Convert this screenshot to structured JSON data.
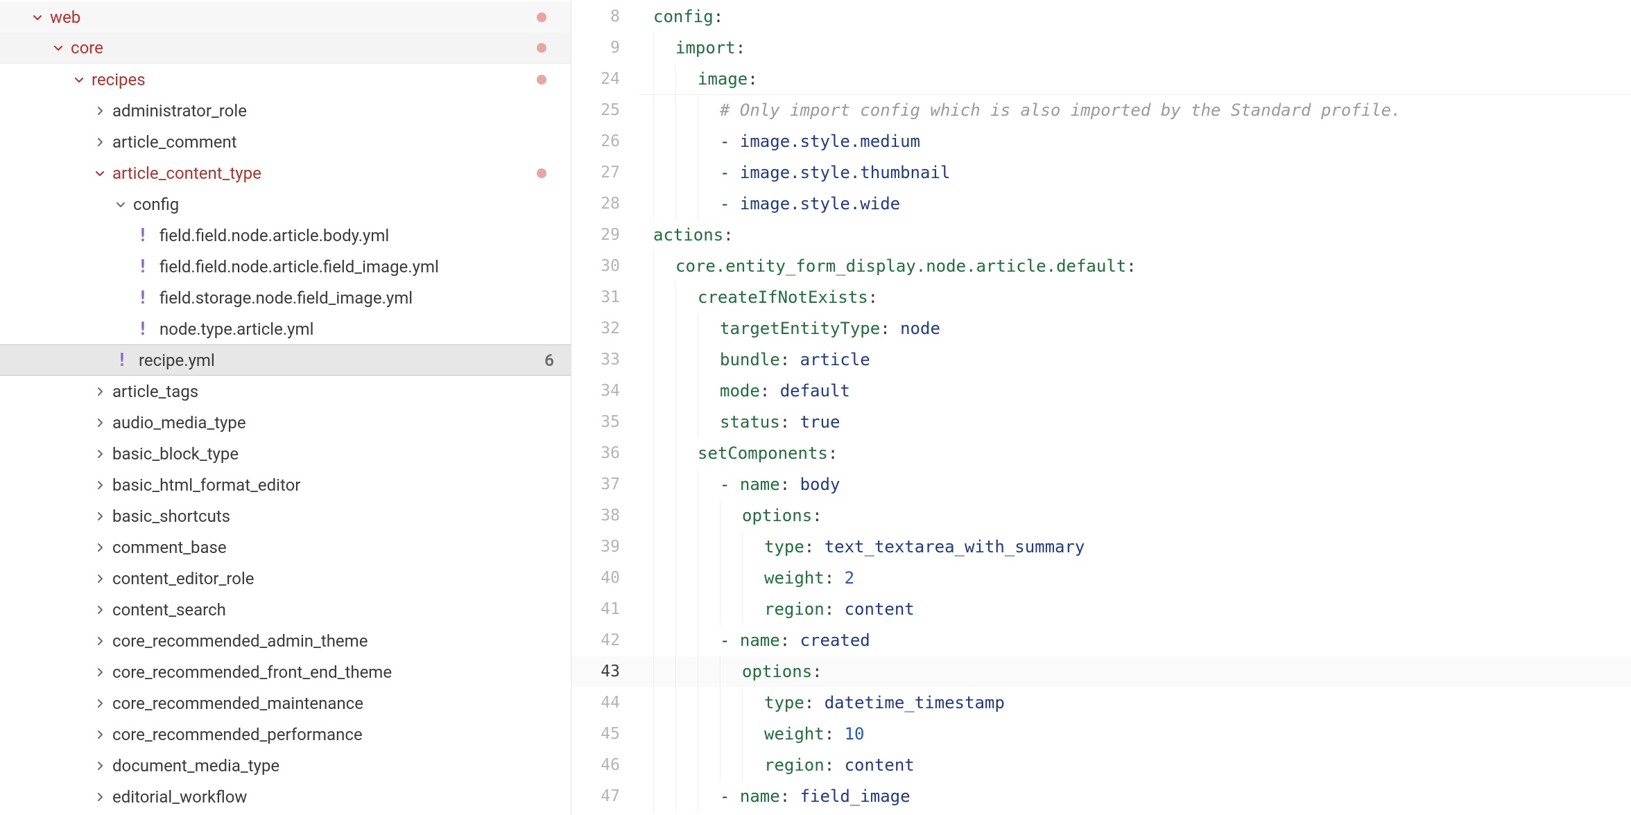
{
  "tree": {
    "items": [
      {
        "label": "web",
        "depth": 0,
        "kind": "dir",
        "expanded": true,
        "modified": true,
        "dot": true,
        "bg": "bg0"
      },
      {
        "label": "core",
        "depth": 1,
        "kind": "dir",
        "expanded": true,
        "modified": true,
        "dot": true,
        "bg": "bg1",
        "separator": true
      },
      {
        "label": "recipes",
        "depth": 2,
        "kind": "dir",
        "expanded": true,
        "modified": true,
        "dot": true
      },
      {
        "label": "administrator_role",
        "depth": 3,
        "kind": "dir",
        "expanded": false
      },
      {
        "label": "article_comment",
        "depth": 3,
        "kind": "dir",
        "expanded": false
      },
      {
        "label": "article_content_type",
        "depth": 3,
        "kind": "dir",
        "expanded": true,
        "modified": true,
        "dot": true
      },
      {
        "label": "config",
        "depth": 4,
        "kind": "dir",
        "expanded": true
      },
      {
        "label": "field.field.node.article.body.yml",
        "depth": 5,
        "kind": "file"
      },
      {
        "label": "field.field.node.article.field_image.yml",
        "depth": 5,
        "kind": "file"
      },
      {
        "label": "field.storage.node.field_image.yml",
        "depth": 5,
        "kind": "file"
      },
      {
        "label": "node.type.article.yml",
        "depth": 5,
        "kind": "file"
      },
      {
        "label": "recipe.yml",
        "depth": 4,
        "kind": "file",
        "selected": true,
        "badge": "6"
      },
      {
        "label": "article_tags",
        "depth": 3,
        "kind": "dir",
        "expanded": false
      },
      {
        "label": "audio_media_type",
        "depth": 3,
        "kind": "dir",
        "expanded": false
      },
      {
        "label": "basic_block_type",
        "depth": 3,
        "kind": "dir",
        "expanded": false
      },
      {
        "label": "basic_html_format_editor",
        "depth": 3,
        "kind": "dir",
        "expanded": false
      },
      {
        "label": "basic_shortcuts",
        "depth": 3,
        "kind": "dir",
        "expanded": false
      },
      {
        "label": "comment_base",
        "depth": 3,
        "kind": "dir",
        "expanded": false
      },
      {
        "label": "content_editor_role",
        "depth": 3,
        "kind": "dir",
        "expanded": false
      },
      {
        "label": "content_search",
        "depth": 3,
        "kind": "dir",
        "expanded": false
      },
      {
        "label": "core_recommended_admin_theme",
        "depth": 3,
        "kind": "dir",
        "expanded": false
      },
      {
        "label": "core_recommended_front_end_theme",
        "depth": 3,
        "kind": "dir",
        "expanded": false
      },
      {
        "label": "core_recommended_maintenance",
        "depth": 3,
        "kind": "dir",
        "expanded": false
      },
      {
        "label": "core_recommended_performance",
        "depth": 3,
        "kind": "dir",
        "expanded": false
      },
      {
        "label": "document_media_type",
        "depth": 3,
        "kind": "dir",
        "expanded": false
      },
      {
        "label": "editorial_workflow",
        "depth": 3,
        "kind": "dir",
        "expanded": false
      }
    ]
  },
  "editor": {
    "current_line": "43",
    "lines": [
      {
        "num": "8",
        "guides": 0,
        "border": false,
        "tokens": [
          {
            "t": "config",
            "c": "key"
          },
          {
            "t": ":",
            "c": "colon"
          }
        ]
      },
      {
        "num": "9",
        "guides": 1,
        "border": false,
        "tokens": [
          {
            "t": "import",
            "c": "key"
          },
          {
            "t": ":",
            "c": "colon"
          }
        ]
      },
      {
        "num": "24",
        "guides": 2,
        "border": true,
        "tokens": [
          {
            "t": "image",
            "c": "key"
          },
          {
            "t": ":",
            "c": "colon"
          }
        ]
      },
      {
        "num": "25",
        "guides": 3,
        "border": false,
        "tokens": [
          {
            "t": "# Only import config which is also imported by the Standard profile.",
            "c": "comment"
          }
        ]
      },
      {
        "num": "26",
        "guides": 3,
        "border": false,
        "tokens": [
          {
            "t": "- ",
            "c": "dash"
          },
          {
            "t": "image.style.medium",
            "c": "plain"
          }
        ]
      },
      {
        "num": "27",
        "guides": 3,
        "border": false,
        "tokens": [
          {
            "t": "- ",
            "c": "dash"
          },
          {
            "t": "image.style.thumbnail",
            "c": "plain"
          }
        ]
      },
      {
        "num": "28",
        "guides": 3,
        "border": false,
        "tokens": [
          {
            "t": "- ",
            "c": "dash"
          },
          {
            "t": "image.style.wide",
            "c": "plain"
          }
        ]
      },
      {
        "num": "29",
        "guides": 0,
        "border": false,
        "tokens": [
          {
            "t": "actions",
            "c": "key"
          },
          {
            "t": ":",
            "c": "colon"
          }
        ]
      },
      {
        "num": "30",
        "guides": 1,
        "border": false,
        "tokens": [
          {
            "t": "core.entity_form_display.node.article.default",
            "c": "key"
          },
          {
            "t": ":",
            "c": "colon"
          }
        ]
      },
      {
        "num": "31",
        "guides": 2,
        "border": false,
        "tokens": [
          {
            "t": "createIfNotExists",
            "c": "key"
          },
          {
            "t": ":",
            "c": "colon"
          }
        ]
      },
      {
        "num": "32",
        "guides": 3,
        "border": false,
        "tokens": [
          {
            "t": "targetEntityType",
            "c": "key"
          },
          {
            "t": ": ",
            "c": "colon"
          },
          {
            "t": "node",
            "c": "str"
          }
        ]
      },
      {
        "num": "33",
        "guides": 3,
        "border": false,
        "tokens": [
          {
            "t": "bundle",
            "c": "key"
          },
          {
            "t": ": ",
            "c": "colon"
          },
          {
            "t": "article",
            "c": "str"
          }
        ]
      },
      {
        "num": "34",
        "guides": 3,
        "border": false,
        "tokens": [
          {
            "t": "mode",
            "c": "key"
          },
          {
            "t": ": ",
            "c": "colon"
          },
          {
            "t": "default",
            "c": "str"
          }
        ]
      },
      {
        "num": "35",
        "guides": 3,
        "border": false,
        "tokens": [
          {
            "t": "status",
            "c": "key"
          },
          {
            "t": ": ",
            "c": "colon"
          },
          {
            "t": "true",
            "c": "bool"
          }
        ]
      },
      {
        "num": "36",
        "guides": 2,
        "border": false,
        "tokens": [
          {
            "t": "setComponents",
            "c": "key"
          },
          {
            "t": ":",
            "c": "colon"
          }
        ]
      },
      {
        "num": "37",
        "guides": 3,
        "border": false,
        "tokens": [
          {
            "t": "- ",
            "c": "dash"
          },
          {
            "t": "name",
            "c": "key"
          },
          {
            "t": ": ",
            "c": "colon"
          },
          {
            "t": "body",
            "c": "str"
          }
        ]
      },
      {
        "num": "38",
        "guides": 4,
        "border": false,
        "tokens": [
          {
            "t": "options",
            "c": "key"
          },
          {
            "t": ":",
            "c": "colon"
          }
        ]
      },
      {
        "num": "39",
        "guides": 5,
        "border": false,
        "tokens": [
          {
            "t": "type",
            "c": "key"
          },
          {
            "t": ": ",
            "c": "colon"
          },
          {
            "t": "text_textarea_with_summary",
            "c": "str"
          }
        ]
      },
      {
        "num": "40",
        "guides": 5,
        "border": false,
        "tokens": [
          {
            "t": "weight",
            "c": "key"
          },
          {
            "t": ": ",
            "c": "colon"
          },
          {
            "t": "2",
            "c": "num"
          }
        ]
      },
      {
        "num": "41",
        "guides": 5,
        "border": false,
        "tokens": [
          {
            "t": "region",
            "c": "key"
          },
          {
            "t": ": ",
            "c": "colon"
          },
          {
            "t": "content",
            "c": "str"
          }
        ]
      },
      {
        "num": "42",
        "guides": 3,
        "border": false,
        "tokens": [
          {
            "t": "- ",
            "c": "dash"
          },
          {
            "t": "name",
            "c": "key"
          },
          {
            "t": ": ",
            "c": "colon"
          },
          {
            "t": "created",
            "c": "str"
          }
        ]
      },
      {
        "num": "43",
        "guides": 4,
        "border": false,
        "current": true,
        "tokens": [
          {
            "t": "options",
            "c": "key"
          },
          {
            "t": ":",
            "c": "colon"
          }
        ]
      },
      {
        "num": "44",
        "guides": 5,
        "border": false,
        "tokens": [
          {
            "t": "type",
            "c": "key"
          },
          {
            "t": ": ",
            "c": "colon"
          },
          {
            "t": "datetime_timestamp",
            "c": "str"
          }
        ]
      },
      {
        "num": "45",
        "guides": 5,
        "border": false,
        "tokens": [
          {
            "t": "weight",
            "c": "key"
          },
          {
            "t": ": ",
            "c": "colon"
          },
          {
            "t": "10",
            "c": "num"
          }
        ]
      },
      {
        "num": "46",
        "guides": 5,
        "border": false,
        "tokens": [
          {
            "t": "region",
            "c": "key"
          },
          {
            "t": ": ",
            "c": "colon"
          },
          {
            "t": "content",
            "c": "str"
          }
        ]
      },
      {
        "num": "47",
        "guides": 3,
        "border": false,
        "tokens": [
          {
            "t": "- ",
            "c": "dash"
          },
          {
            "t": "name",
            "c": "key"
          },
          {
            "t": ": ",
            "c": "colon"
          },
          {
            "t": "field_image",
            "c": "str"
          }
        ]
      }
    ]
  },
  "icons": {
    "yaml_file_glyph": "!"
  }
}
